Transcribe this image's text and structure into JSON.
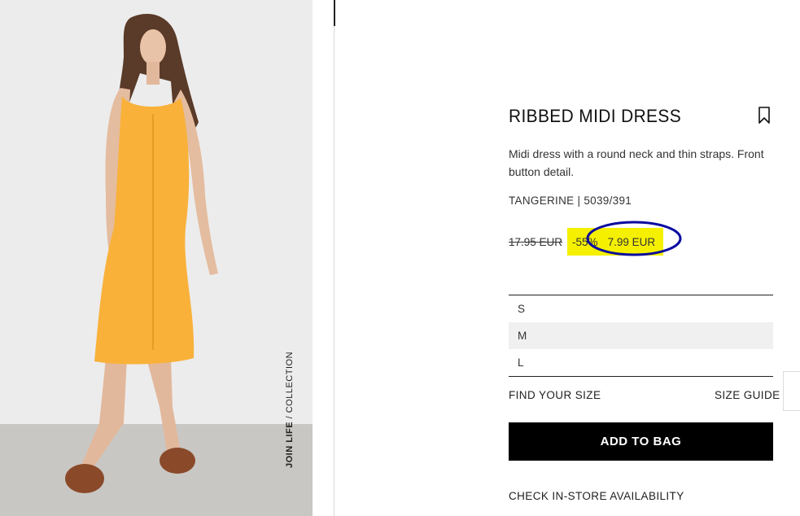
{
  "product": {
    "title": "RIBBED MIDI DRESS",
    "description": "Midi dress with a round neck and thin straps. Front button detail.",
    "color_ref": "TANGERINE | 5039/391",
    "old_price": "17.95 EUR",
    "discount": "-55%",
    "new_price": "7.99 EUR",
    "highlight_color": "#f5f000",
    "annotation_color": "#0a0aa0"
  },
  "image": {
    "join_life_bold": "JOIN LIFE",
    "join_life_rest": " / COLLECTION",
    "dress_color": "#f9b13a"
  },
  "sizes": [
    "S",
    "M",
    "L"
  ],
  "selected_size": "M",
  "links": {
    "find_size": "FIND YOUR SIZE",
    "size_guide": "SIZE GUIDE",
    "check_store": "CHECK IN-STORE AVAILABILITY"
  },
  "buttons": {
    "add_to_bag": "ADD TO BAG"
  },
  "icons": {
    "bookmark": "bookmark-icon"
  }
}
